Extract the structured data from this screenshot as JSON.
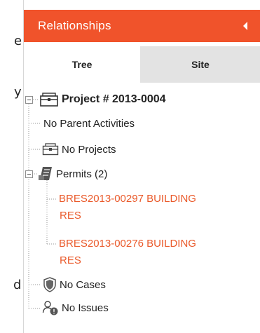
{
  "background_fragments": [
    "e",
    "y",
    "d"
  ],
  "panel": {
    "title": "Relationships",
    "collapse_icon": "caret-left-icon",
    "accent_color": "#f0532b",
    "link_color": "#ea5a2b"
  },
  "tabs": [
    {
      "label": "Tree",
      "active": true
    },
    {
      "label": "Site",
      "active": false
    }
  ],
  "tree": {
    "root": {
      "label": "Project # 2013-0004",
      "icon": "briefcase-icon",
      "expanded": true
    },
    "parent_activities": {
      "label": "No Parent Activities"
    },
    "projects": {
      "label": "No Projects",
      "icon": "briefcase-icon"
    },
    "permits": {
      "label": "Permits (2)",
      "icon": "permit-document-icon",
      "expanded": true,
      "items": [
        {
          "line1": "BRES2013-00297 BUILDING",
          "line2": "RES"
        },
        {
          "line1": "BRES2013-00276 BUILDING",
          "line2": "RES"
        }
      ]
    },
    "cases": {
      "label": "No Cases",
      "icon": "shield-icon"
    },
    "issues": {
      "label": "No Issues",
      "icon": "users-alert-icon"
    }
  }
}
